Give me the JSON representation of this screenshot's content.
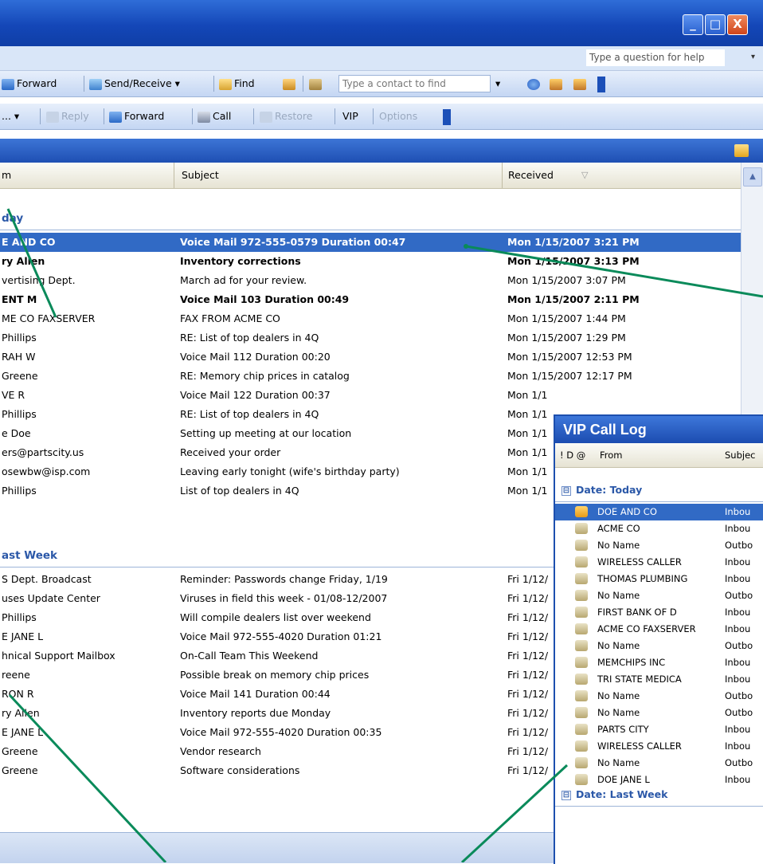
{
  "window": {
    "minimize": "_",
    "maximize": "□",
    "close": "X"
  },
  "menubar": {
    "help_placeholder": "Type a question for help",
    "help_drop": "▾"
  },
  "toolbar1": {
    "forward": "Forward",
    "send_receive": "Send/Receive",
    "send_receive_drop": "▾",
    "find": "Find",
    "contact_placeholder": "Type a contact to find",
    "contact_drop": "▾"
  },
  "toolbar2": {
    "first": "...",
    "first_drop": "▾",
    "reply": "Reply",
    "forward": "Forward",
    "call": "Call",
    "restore": "Restore",
    "vip": "VIP",
    "options": "Options"
  },
  "columns": {
    "from": "m",
    "subject": "Subject",
    "received": "Received",
    "sort": "▽"
  },
  "groups": [
    {
      "label": "day"
    },
    {
      "label": "ast Week"
    }
  ],
  "today_rows": [
    {
      "from": "E AND CO",
      "subject": "Voice Mail  972-555-0579  Duration  00:47",
      "received": "Mon 1/15/2007 3:21 PM",
      "selected": true,
      "bold": true
    },
    {
      "from": "ry Allen",
      "subject": "Inventory corrections",
      "received": "Mon 1/15/2007 3:13 PM",
      "bold": true
    },
    {
      "from": "vertising Dept.",
      "subject": "March ad for your review.",
      "received": "Mon 1/15/2007 3:07 PM"
    },
    {
      "from": "ENT M",
      "subject": "Voice Mail  103  Duration  00:49",
      "received": "Mon 1/15/2007 2:11 PM",
      "bold": true
    },
    {
      "from": "ME CO FAXSERVER",
      "subject": "FAX FROM ACME CO",
      "received": "Mon 1/15/2007 1:44 PM"
    },
    {
      "from": "Phillips",
      "subject": "RE: List of top dealers in 4Q",
      "received": "Mon 1/15/2007 1:29 PM"
    },
    {
      "from": "RAH W",
      "subject": "Voice Mail  112  Duration  00:20",
      "received": "Mon 1/15/2007 12:53 PM"
    },
    {
      "from": "Greene",
      "subject": "RE: Memory chip prices in catalog",
      "received": "Mon 1/15/2007 12:17 PM"
    },
    {
      "from": "VE R",
      "subject": "Voice Mail  122  Duration  00:37",
      "received": "Mon 1/1"
    },
    {
      "from": "Phillips",
      "subject": "RE: List of top dealers in 4Q",
      "received": "Mon 1/1"
    },
    {
      "from": "e Doe",
      "subject": "Setting up meeting at our location",
      "received": "Mon 1/1"
    },
    {
      "from": "ers@partscity.us",
      "subject": "Received your order",
      "received": "Mon 1/1"
    },
    {
      "from": "osewbw@isp.com",
      "subject": "Leaving early tonight (wife's birthday party)",
      "received": "Mon 1/1"
    },
    {
      "from": "Phillips",
      "subject": "List of top dealers in 4Q",
      "received": "Mon 1/1"
    }
  ],
  "lastweek_rows": [
    {
      "from": "S Dept. Broadcast",
      "subject": "Reminder: Passwords change Friday, 1/19",
      "received": "Fri 1/12/"
    },
    {
      "from": "uses Update Center",
      "subject": "Viruses in field this week - 01/08-12/2007",
      "received": "Fri 1/12/"
    },
    {
      "from": "Phillips",
      "subject": "Will compile dealers list over weekend",
      "received": "Fri 1/12/"
    },
    {
      "from": "E JANE L",
      "subject": "Voice Mail  972-555-4020  Duration  01:21",
      "received": "Fri 1/12/"
    },
    {
      "from": "hnical Support Mailbox",
      "subject": "On-Call Team This Weekend",
      "received": "Fri 1/12/"
    },
    {
      "from": "reene",
      "subject": "Possible break on memory chip prices",
      "received": "Fri 1/12/"
    },
    {
      "from": "RON R",
      "subject": "Voice Mail  141  Duration  00:44",
      "received": "Fri 1/12/"
    },
    {
      "from": "ry Allen",
      "subject": "Inventory reports due Monday",
      "received": "Fri 1/12/"
    },
    {
      "from": "E JANE L",
      "subject": "Voice Mail  972-555-4020  Duration  00:35",
      "received": "Fri 1/12/"
    },
    {
      "from": "Greene",
      "subject": "Vendor research",
      "received": "Fri 1/12/"
    },
    {
      "from": "Greene",
      "subject": "Software considerations",
      "received": "Fri 1/12/"
    }
  ],
  "vip": {
    "title": "VIP Call Log",
    "col_icons": "! D @",
    "col_from": "From",
    "col_subject": "Subjec",
    "group_today": "Date: Today",
    "group_lastweek": "Date: Last Week",
    "group_box": "⊟",
    "rows": [
      {
        "from": "DOE AND CO",
        "subject": "Inbou",
        "selected": true
      },
      {
        "from": "ACME CO",
        "subject": "Inbou"
      },
      {
        "from": "No Name",
        "subject": "Outbo"
      },
      {
        "from": "WIRELESS CALLER",
        "subject": "Inbou"
      },
      {
        "from": "THOMAS PLUMBING",
        "subject": "Inbou"
      },
      {
        "from": "No Name",
        "subject": "Outbo"
      },
      {
        "from": "FIRST BANK OF D",
        "subject": "Inbou"
      },
      {
        "from": "ACME CO FAXSERVER",
        "subject": "Inbou"
      },
      {
        "from": "No Name",
        "subject": "Outbo"
      },
      {
        "from": "MEMCHIPS INC",
        "subject": "Inbou"
      },
      {
        "from": "TRI STATE MEDICA",
        "subject": "Inbou"
      },
      {
        "from": "No Name",
        "subject": "Outbo"
      },
      {
        "from": "No Name",
        "subject": "Outbo"
      },
      {
        "from": "PARTS CITY",
        "subject": "Inbou"
      },
      {
        "from": "WIRELESS CALLER",
        "subject": "Inbou"
      },
      {
        "from": "No Name",
        "subject": "Outbo"
      },
      {
        "from": "DOE JANE L",
        "subject": "Inbou"
      }
    ]
  },
  "colors": {
    "callout": "#0a8a5a",
    "selection": "#316ac5",
    "group_text": "#2b58a8"
  }
}
